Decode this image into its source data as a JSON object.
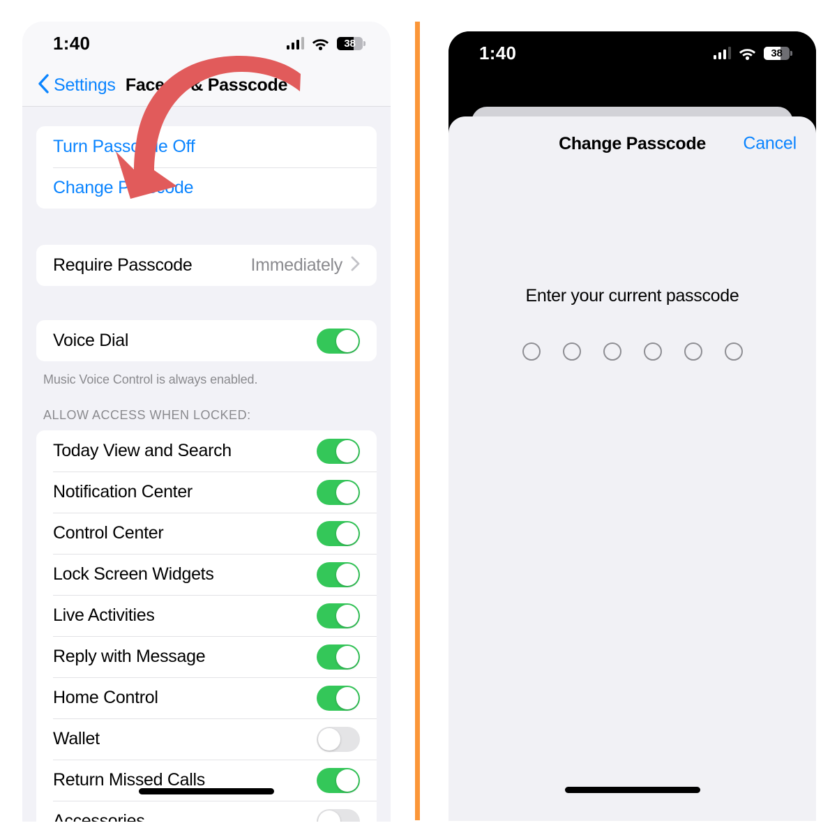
{
  "divider": {
    "color": "#fb9638"
  },
  "left_phone": {
    "status_bar": {
      "time": "1:40",
      "battery_level": "38",
      "signal_icon": "cellular-signal-icon",
      "wifi_icon": "wifi-icon",
      "battery_icon": "battery-icon"
    },
    "nav": {
      "back_label": "Settings",
      "back_icon": "chevron-left-icon",
      "title": "Face ID & Passcode"
    },
    "passcode_group": [
      {
        "label": "Turn Passcode Off",
        "type": "link"
      },
      {
        "label": "Change Passcode",
        "type": "link"
      }
    ],
    "require_group": [
      {
        "label": "Require Passcode",
        "value": "Immediately",
        "type": "disclosure"
      }
    ],
    "voice_group": [
      {
        "label": "Voice Dial",
        "toggle": "on"
      }
    ],
    "voice_footnote": "Music Voice Control is always enabled.",
    "allow_access_header": "ALLOW ACCESS WHEN LOCKED:",
    "allow_access_rows": [
      {
        "label": "Today View and Search",
        "toggle": "on"
      },
      {
        "label": "Notification Center",
        "toggle": "on"
      },
      {
        "label": "Control Center",
        "toggle": "on"
      },
      {
        "label": "Lock Screen Widgets",
        "toggle": "on"
      },
      {
        "label": "Live Activities",
        "toggle": "on"
      },
      {
        "label": "Reply with Message",
        "toggle": "on"
      },
      {
        "label": "Home Control",
        "toggle": "on"
      },
      {
        "label": "Wallet",
        "toggle": "off"
      },
      {
        "label": "Return Missed Calls",
        "toggle": "on"
      },
      {
        "label": "Accessories",
        "toggle": "off"
      }
    ],
    "annotation": {
      "type": "curved-arrow",
      "color": "#e15b5b",
      "points_at": "Change Passcode"
    }
  },
  "right_phone": {
    "status_bar": {
      "time": "1:40",
      "battery_level": "38",
      "signal_icon": "cellular-signal-icon",
      "wifi_icon": "wifi-icon",
      "battery_icon": "battery-icon"
    },
    "sheet": {
      "title": "Change Passcode",
      "cancel_label": "Cancel",
      "prompt": "Enter your current passcode",
      "passcode_dots": {
        "total": 6,
        "filled": 0
      }
    }
  }
}
